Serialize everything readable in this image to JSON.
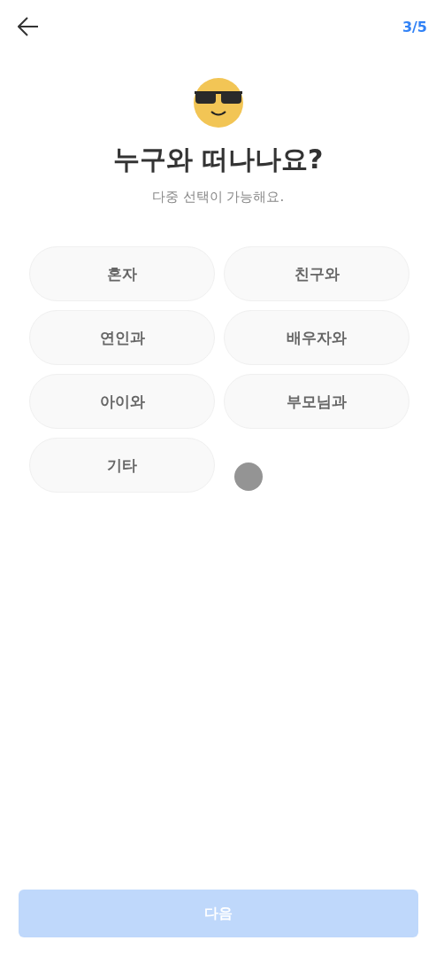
{
  "header": {
    "step": "3/5"
  },
  "title": "누구와 떠나나요?",
  "subtitle": "다중 선택이 가능해요.",
  "options": [
    {
      "label": "혼자",
      "selected": false
    },
    {
      "label": "친구와",
      "selected": false
    },
    {
      "label": "연인과",
      "selected": false
    },
    {
      "label": "배우자와",
      "selected": false
    },
    {
      "label": "아이와",
      "selected": false
    },
    {
      "label": "부모님과",
      "selected": false
    },
    {
      "label": "기타",
      "selected": false
    }
  ],
  "next_button": {
    "label": "다음",
    "disabled": true
  }
}
